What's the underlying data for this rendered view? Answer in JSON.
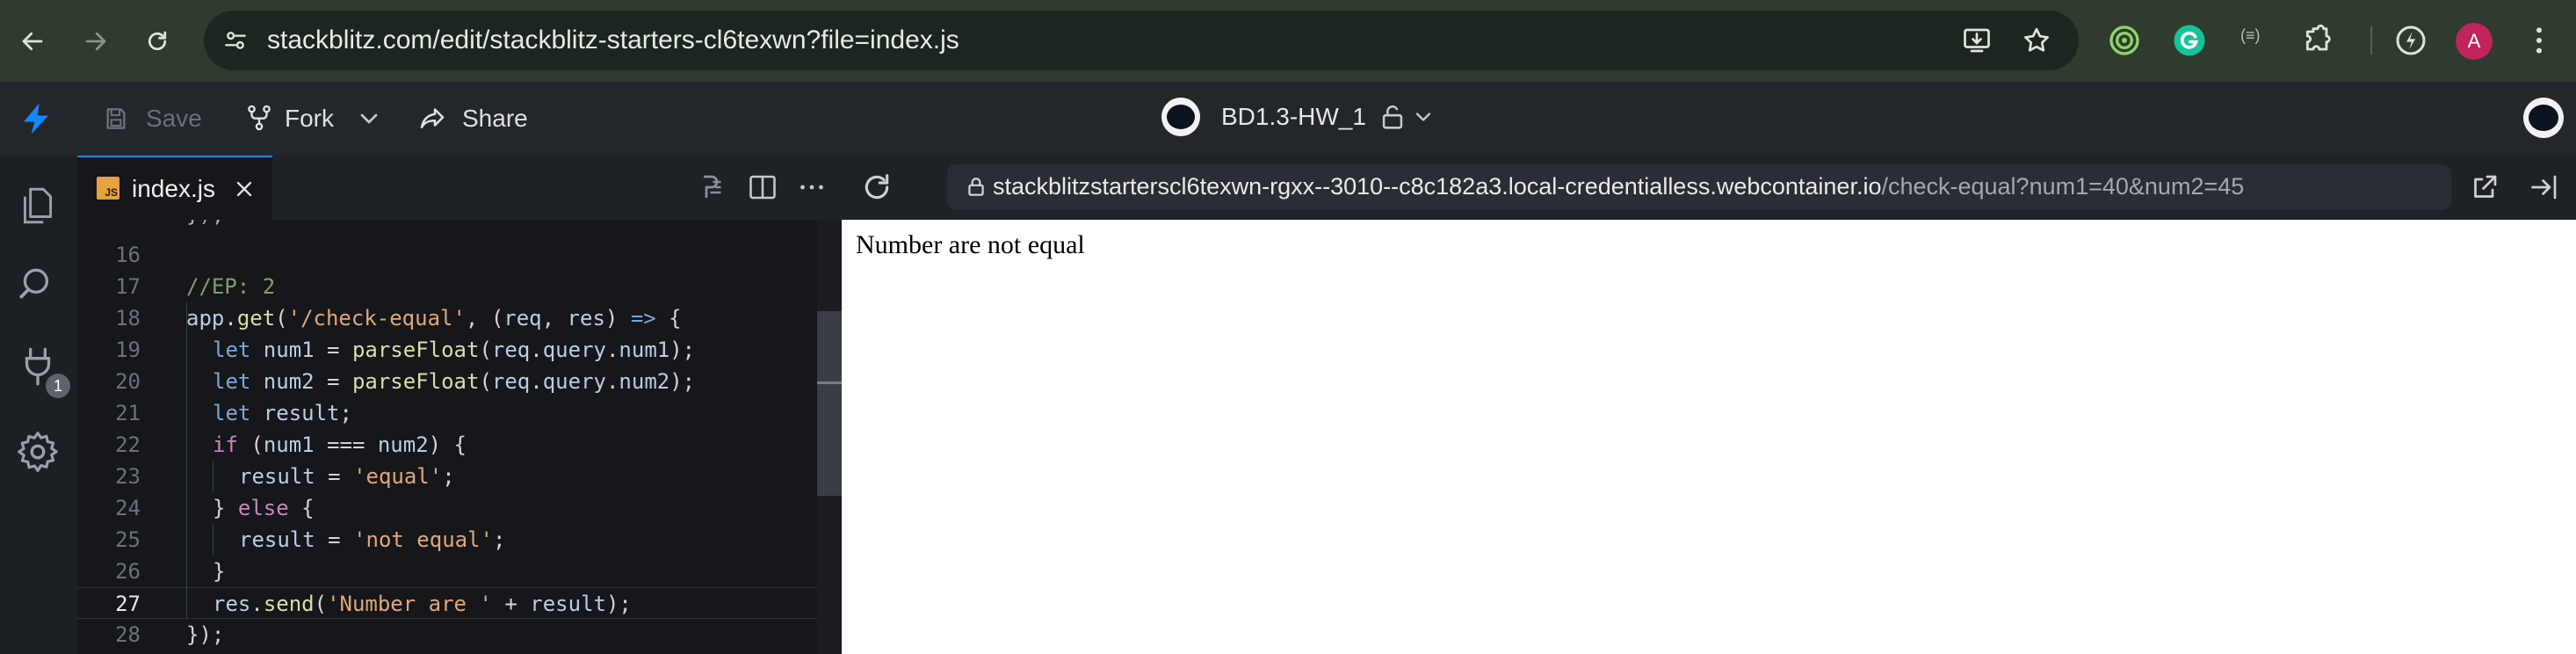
{
  "browser": {
    "url": "stackblitz.com/edit/stackblitz-starters-cl6texwn?file=index.js",
    "avatar_letter": "A",
    "extension_badge": "(≡)"
  },
  "toolbar": {
    "save_label": "Save",
    "fork_label": "Fork",
    "share_label": "Share",
    "project_name": "BD1.3-HW_1"
  },
  "sidebar": {
    "plugin_badge": "1"
  },
  "editor": {
    "tab_label": "index.js",
    "file_badge": "JS",
    "lines": [
      {
        "n": "16",
        "indent": 0,
        "tokens": []
      },
      {
        "n": "17",
        "indent": 0,
        "tokens": [
          {
            "t": "//EP: 2",
            "c": "cm"
          }
        ]
      },
      {
        "n": "18",
        "indent": 0,
        "tokens": [
          {
            "t": "app",
            "c": "var"
          },
          {
            "t": ".",
            "c": "pl"
          },
          {
            "t": "get",
            "c": "fn"
          },
          {
            "t": "(",
            "c": "pl"
          },
          {
            "t": "'/check-equal'",
            "c": "str"
          },
          {
            "t": ", (",
            "c": "pl"
          },
          {
            "t": "req",
            "c": "var"
          },
          {
            "t": ", ",
            "c": "pl"
          },
          {
            "t": "res",
            "c": "var"
          },
          {
            "t": ") ",
            "c": "pl"
          },
          {
            "t": "=>",
            "c": "kw2"
          },
          {
            "t": " {",
            "c": "pl"
          }
        ]
      },
      {
        "n": "19",
        "indent": 1,
        "tokens": [
          {
            "t": "let ",
            "c": "kw2"
          },
          {
            "t": "num1",
            "c": "var"
          },
          {
            "t": " = ",
            "c": "pl"
          },
          {
            "t": "parseFloat",
            "c": "fn"
          },
          {
            "t": "(",
            "c": "pl"
          },
          {
            "t": "req",
            "c": "var"
          },
          {
            "t": ".",
            "c": "pl"
          },
          {
            "t": "query",
            "c": "var"
          },
          {
            "t": ".",
            "c": "pl"
          },
          {
            "t": "num1",
            "c": "var"
          },
          {
            "t": ");",
            "c": "pl"
          }
        ]
      },
      {
        "n": "20",
        "indent": 1,
        "tokens": [
          {
            "t": "let ",
            "c": "kw2"
          },
          {
            "t": "num2",
            "c": "var"
          },
          {
            "t": " = ",
            "c": "pl"
          },
          {
            "t": "parseFloat",
            "c": "fn"
          },
          {
            "t": "(",
            "c": "pl"
          },
          {
            "t": "req",
            "c": "var"
          },
          {
            "t": ".",
            "c": "pl"
          },
          {
            "t": "query",
            "c": "var"
          },
          {
            "t": ".",
            "c": "pl"
          },
          {
            "t": "num2",
            "c": "var"
          },
          {
            "t": ");",
            "c": "pl"
          }
        ]
      },
      {
        "n": "21",
        "indent": 1,
        "tokens": [
          {
            "t": "let ",
            "c": "kw2"
          },
          {
            "t": "result",
            "c": "var"
          },
          {
            "t": ";",
            "c": "pl"
          }
        ]
      },
      {
        "n": "22",
        "indent": 1,
        "tokens": [
          {
            "t": "if ",
            "c": "kw"
          },
          {
            "t": "(",
            "c": "pl"
          },
          {
            "t": "num1",
            "c": "var"
          },
          {
            "t": " === ",
            "c": "pl"
          },
          {
            "t": "num2",
            "c": "var"
          },
          {
            "t": ") {",
            "c": "pl"
          }
        ]
      },
      {
        "n": "23",
        "indent": 2,
        "tokens": [
          {
            "t": "result",
            "c": "var"
          },
          {
            "t": " = ",
            "c": "pl"
          },
          {
            "t": "'equal'",
            "c": "str"
          },
          {
            "t": ";",
            "c": "pl"
          }
        ]
      },
      {
        "n": "24",
        "indent": 1,
        "tokens": [
          {
            "t": "} ",
            "c": "pl"
          },
          {
            "t": "else",
            "c": "kw"
          },
          {
            "t": " {",
            "c": "pl"
          }
        ]
      },
      {
        "n": "25",
        "indent": 2,
        "tokens": [
          {
            "t": "result",
            "c": "var"
          },
          {
            "t": " = ",
            "c": "pl"
          },
          {
            "t": "'not equal'",
            "c": "str"
          },
          {
            "t": ";",
            "c": "pl"
          }
        ]
      },
      {
        "n": "26",
        "indent": 1,
        "tokens": [
          {
            "t": "}",
            "c": "pl"
          }
        ]
      },
      {
        "n": "27",
        "indent": 1,
        "tokens": [
          {
            "t": "res",
            "c": "var"
          },
          {
            "t": ".",
            "c": "pl"
          },
          {
            "t": "send",
            "c": "fn"
          },
          {
            "t": "(",
            "c": "pl"
          },
          {
            "t": "'Number are '",
            "c": "str"
          },
          {
            "t": " + ",
            "c": "pl"
          },
          {
            "t": "result",
            "c": "var"
          },
          {
            "t": ");",
            "c": "pl"
          }
        ]
      },
      {
        "n": "28",
        "indent": 0,
        "tokens": [
          {
            "t": "});",
            "c": "pl"
          }
        ]
      }
    ],
    "active_line": "27"
  },
  "preview": {
    "url_host": "stackblitzstarterscl6texwn-rgxx--3010--c8c182a3.local-credentialless.webcontainer.io",
    "url_path": "/check-equal?num1=40&num2=45",
    "body_text": "Number are not equal"
  },
  "colors": {
    "accent": "#1389fd",
    "chrome_bg": "#2f3b2e"
  }
}
